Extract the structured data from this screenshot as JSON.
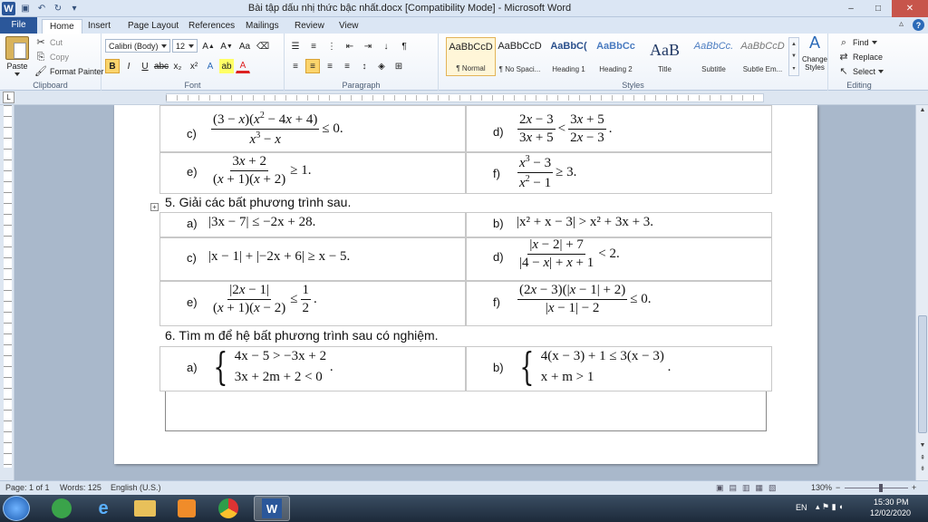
{
  "window": {
    "title": "Bài tập dấu nhị thức bậc nhất.docx [Compatibility Mode]  -  Microsoft Word",
    "app_logo": "W",
    "controls": [
      "–",
      "□",
      "✕"
    ]
  },
  "tabs": {
    "file": "File",
    "items": [
      "Home",
      "Insert",
      "Page Layout",
      "References",
      "Mailings",
      "Review",
      "View"
    ],
    "active": "Home"
  },
  "ribbon": {
    "clipboard": {
      "paste": "Paste",
      "cut": "Cut",
      "copy": "Copy",
      "format_painter": "Format Painter",
      "label": "Clipboard"
    },
    "font": {
      "family": "Calibri (Body)",
      "size": "12",
      "label": "Font"
    },
    "paragraph": {
      "label": "Paragraph"
    },
    "styles": {
      "label": "Styles",
      "items": [
        {
          "sample": "AaBbCcD",
          "name": "¶ Normal"
        },
        {
          "sample": "AaBbCcD",
          "name": "¶ No Spaci..."
        },
        {
          "sample": "AaBbC(",
          "name": "Heading 1"
        },
        {
          "sample": "AaBbCc",
          "name": "Heading 2"
        },
        {
          "sample": "AaB",
          "name": "Title"
        },
        {
          "sample": "AaBbCc.",
          "name": "Subtitle"
        },
        {
          "sample": "AaBbCcD",
          "name": "Subtle Em..."
        }
      ],
      "change_styles": "Change Styles"
    },
    "editing": {
      "find": "Find",
      "replace": "Replace",
      "select": "Select",
      "label": "Editing"
    }
  },
  "document": {
    "q4": {
      "c_label": "c)",
      "c_expr": "≤ 0.",
      "d_label": "d)",
      "d_expr": ".",
      "e_label": "e)",
      "e_expr": "≥ 1.",
      "f_label": "f)",
      "f_expr": "≥ 3."
    },
    "q5": {
      "heading": "5. Giải các bất phương trình sau.",
      "a_label": "a)",
      "a_expr": "|3x − 7| ≤ −2x + 28.",
      "b_label": "b)",
      "b_expr": "|x² + x − 3| > x² + 3x + 3.",
      "c_label": "c)",
      "c_expr": "|x − 1| + |−2x + 6| ≥ x − 5.",
      "d_label": "d)",
      "d_expr": "< 2.",
      "e_label": "e)",
      "e_expr": "≤",
      "f_label": "f)",
      "f_expr": "≤ 0."
    },
    "q6": {
      "heading": "6. Tìm m để hệ bất phương trình sau có nghiệm.",
      "a_label": "a)",
      "a_row1": "4x − 5 > −3x + 2",
      "a_row2": "3x + 2m + 2 < 0",
      "b_label": "b)",
      "b_row1": "4(x − 3) + 1 ≤ 3(x − 3)",
      "b_row2": "x + m > 1"
    }
  },
  "status": {
    "page": "Page: 1 of 1",
    "words": "Words: 125",
    "language": "English (U.S.)",
    "zoom": "130%"
  },
  "taskbar": {
    "lang": "EN",
    "time": "15:30 PM",
    "date": "12/02/2020"
  }
}
